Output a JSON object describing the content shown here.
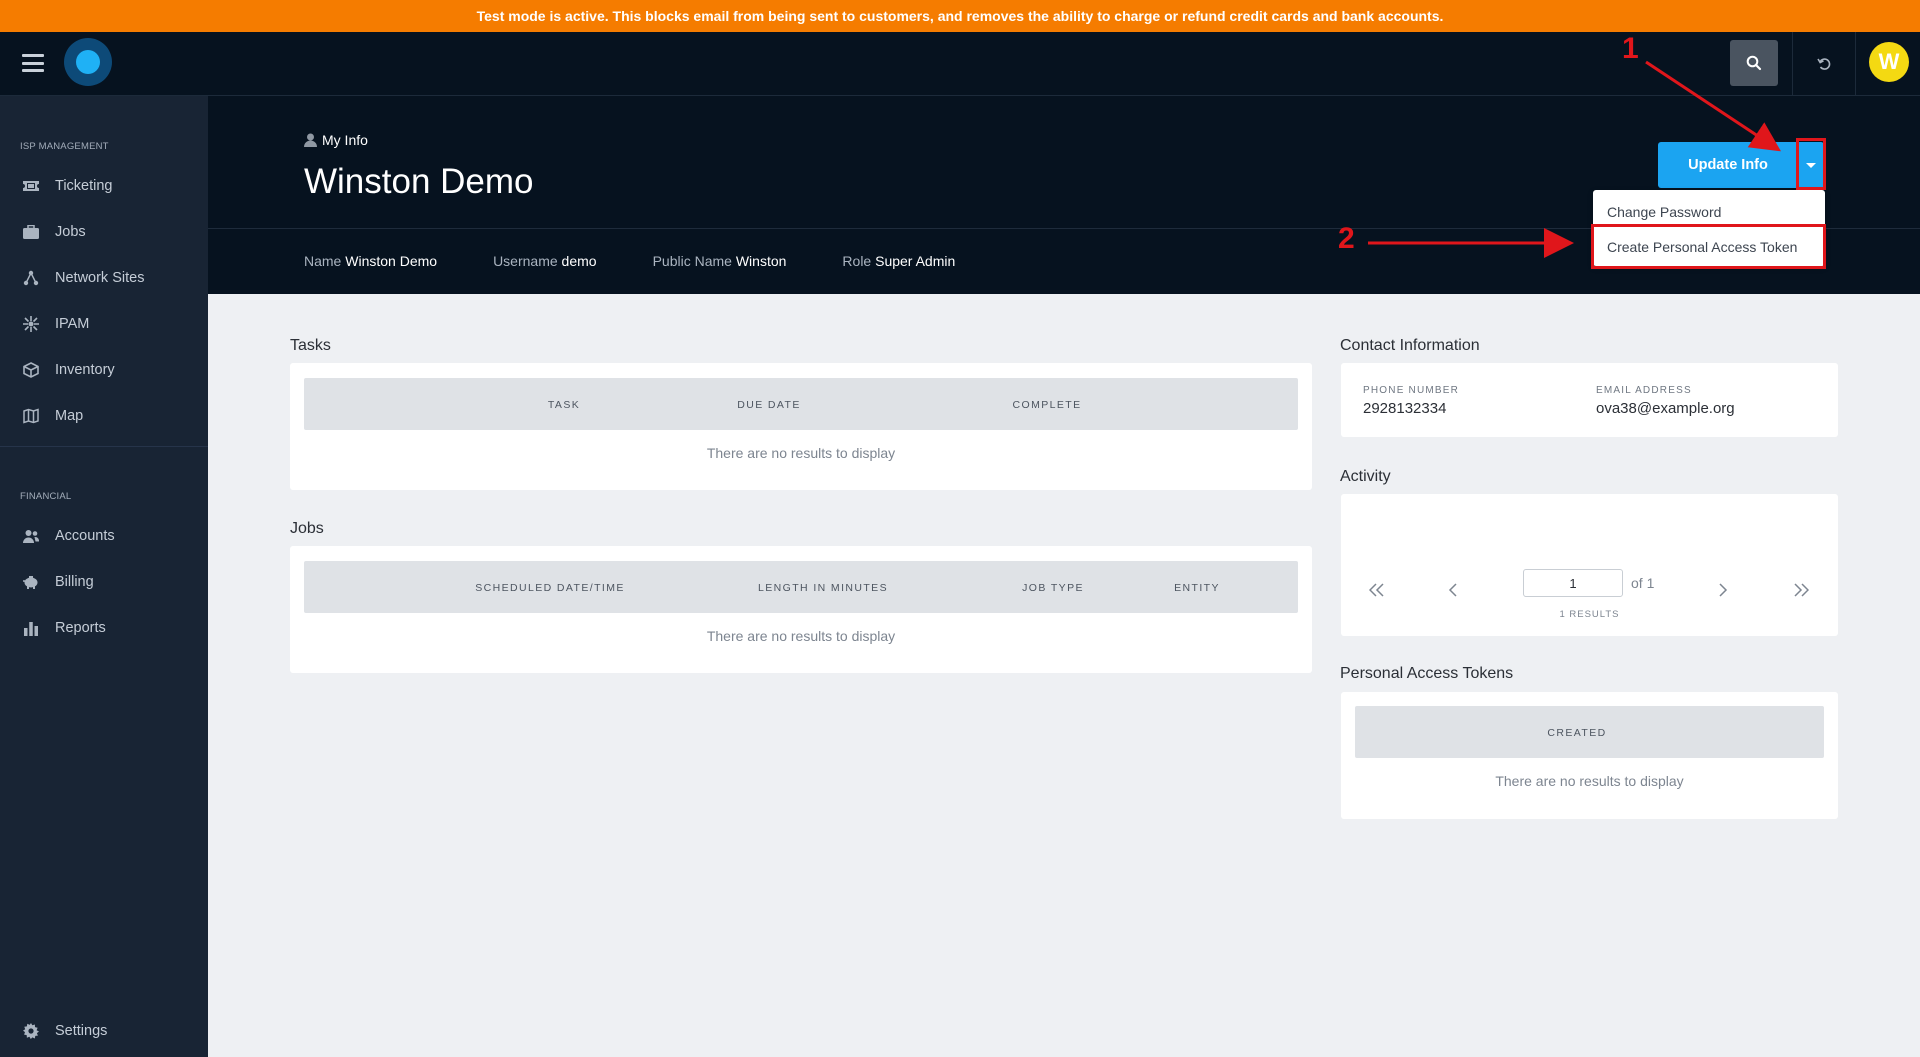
{
  "banner": {
    "text": "Test mode is active. This blocks email from being sent to customers, and removes the ability to charge or refund credit cards and bank accounts."
  },
  "topbar": {
    "avatar_initial": "W"
  },
  "sidebar": {
    "section_isp": "ISP MANAGEMENT",
    "section_financial": "FINANCIAL",
    "isp_items": [
      {
        "label": "Ticketing",
        "icon": "ticket-icon"
      },
      {
        "label": "Jobs",
        "icon": "briefcase-icon"
      },
      {
        "label": "Network Sites",
        "icon": "network-icon"
      },
      {
        "label": "IPAM",
        "icon": "ipam-icon"
      },
      {
        "label": "Inventory",
        "icon": "box-icon"
      },
      {
        "label": "Map",
        "icon": "map-icon"
      }
    ],
    "financial_items": [
      {
        "label": "Accounts",
        "icon": "users-icon"
      },
      {
        "label": "Billing",
        "icon": "piggy-bank-icon"
      },
      {
        "label": "Reports",
        "icon": "bar-chart-icon"
      }
    ],
    "settings_label": "Settings"
  },
  "header": {
    "breadcrumb": "My Info",
    "title": "Winston Demo",
    "fields": [
      {
        "key": "Name",
        "value": "Winston Demo"
      },
      {
        "key": "Username",
        "value": "demo"
      },
      {
        "key": "Public Name",
        "value": "Winston"
      },
      {
        "key": "Role",
        "value": "Super Admin"
      }
    ],
    "update_button": "Update Info",
    "dropdown": [
      "Change Password",
      "Create Personal Access Token"
    ]
  },
  "annotations": {
    "callout_1": "1",
    "callout_2": "2"
  },
  "tasks": {
    "title": "Tasks",
    "columns": [
      "TASK",
      "DUE DATE",
      "COMPLETE"
    ],
    "empty": "There are no results to display"
  },
  "jobs": {
    "title": "Jobs",
    "columns": [
      "SCHEDULED DATE/TIME",
      "LENGTH IN MINUTES",
      "JOB TYPE",
      "ENTITY"
    ],
    "empty": "There are no results to display"
  },
  "contact": {
    "title": "Contact Information",
    "phone_label": "PHONE NUMBER",
    "phone": "2928132334",
    "email_label": "EMAIL ADDRESS",
    "email": "ova38@example.org"
  },
  "activity": {
    "title": "Activity",
    "page": "1",
    "of": "of 1",
    "results": "1 RESULTS"
  },
  "tokens": {
    "title": "Personal Access Tokens",
    "columns": [
      "CREATED"
    ],
    "empty": "There are no results to display"
  },
  "colors": {
    "banner": "#f57c00",
    "accent": "#1ba4f1",
    "dark": "#06121f",
    "sidebar": "#182434",
    "callout": "#e0161b"
  }
}
